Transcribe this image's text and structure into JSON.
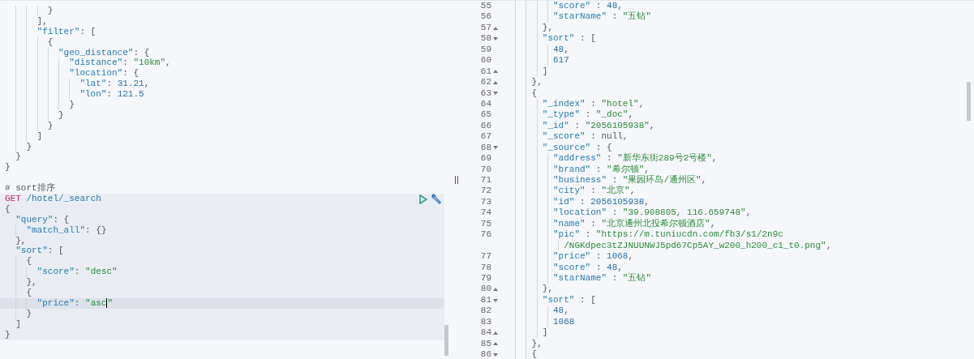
{
  "console": {
    "lines": [
      {
        "segments": [
          {
            "kind": "punct",
            "text": "        }"
          }
        ]
      },
      {
        "segments": [
          {
            "kind": "punct",
            "text": "      ],"
          }
        ]
      },
      {
        "segments": [
          {
            "kind": "key",
            "text": "      \"filter\""
          },
          {
            "kind": "punct",
            "text": ": ["
          }
        ]
      },
      {
        "segments": [
          {
            "kind": "punct",
            "text": "        {"
          }
        ]
      },
      {
        "segments": [
          {
            "kind": "key",
            "text": "          \"geo_distance\""
          },
          {
            "kind": "punct",
            "text": ": {"
          }
        ]
      },
      {
        "segments": [
          {
            "kind": "key",
            "text": "            \"distance\""
          },
          {
            "kind": "punct",
            "text": ": "
          },
          {
            "kind": "string",
            "text": "\"10km\""
          },
          {
            "kind": "punct",
            "text": ","
          }
        ]
      },
      {
        "segments": [
          {
            "kind": "key",
            "text": "            \"location\""
          },
          {
            "kind": "punct",
            "text": ": {"
          }
        ]
      },
      {
        "segments": [
          {
            "kind": "key",
            "text": "              \"lat\""
          },
          {
            "kind": "punct",
            "text": ": "
          },
          {
            "kind": "number",
            "text": "31.21"
          },
          {
            "kind": "punct",
            "text": ","
          }
        ]
      },
      {
        "segments": [
          {
            "kind": "key",
            "text": "              \"lon\""
          },
          {
            "kind": "punct",
            "text": ": "
          },
          {
            "kind": "number",
            "text": "121.5"
          }
        ]
      },
      {
        "segments": [
          {
            "kind": "punct",
            "text": "            }"
          }
        ]
      },
      {
        "segments": [
          {
            "kind": "punct",
            "text": "          }"
          }
        ]
      },
      {
        "segments": [
          {
            "kind": "punct",
            "text": "        }"
          }
        ]
      },
      {
        "segments": [
          {
            "kind": "punct",
            "text": "      ]"
          }
        ]
      },
      {
        "segments": [
          {
            "kind": "punct",
            "text": "    }"
          }
        ]
      },
      {
        "segments": [
          {
            "kind": "punct",
            "text": "  }"
          }
        ]
      },
      {
        "segments": [
          {
            "kind": "punct",
            "text": "}"
          }
        ]
      },
      {
        "segments": [
          {
            "kind": "comment",
            "text": "# sort排序"
          }
        ]
      }
    ],
    "request": {
      "lines": [
        {
          "active": false,
          "segments": [
            {
              "kind": "method",
              "text": "GET"
            },
            {
              "kind": "url",
              "text": " /hotel/_search"
            }
          ]
        },
        {
          "active": false,
          "segments": [
            {
              "kind": "punct",
              "text": "{"
            }
          ]
        },
        {
          "active": false,
          "segments": [
            {
              "kind": "key",
              "text": "  \"query\""
            },
            {
              "kind": "punct",
              "text": ": {"
            }
          ]
        },
        {
          "active": false,
          "segments": [
            {
              "kind": "key",
              "text": "    \"match_all\""
            },
            {
              "kind": "punct",
              "text": ": {}"
            }
          ]
        },
        {
          "active": false,
          "segments": [
            {
              "kind": "punct",
              "text": "  },"
            }
          ]
        },
        {
          "active": false,
          "segments": [
            {
              "kind": "key",
              "text": "  \"sort\""
            },
            {
              "kind": "punct",
              "text": ": ["
            }
          ]
        },
        {
          "active": false,
          "segments": [
            {
              "kind": "punct",
              "text": "    {"
            }
          ]
        },
        {
          "active": false,
          "segments": [
            {
              "kind": "key",
              "text": "      \"score\""
            },
            {
              "kind": "punct",
              "text": ": "
            },
            {
              "kind": "string",
              "text": "\"desc\""
            }
          ]
        },
        {
          "active": false,
          "segments": [
            {
              "kind": "punct",
              "text": "    },"
            }
          ]
        },
        {
          "active": false,
          "segments": [
            {
              "kind": "punct",
              "text": "    {"
            }
          ]
        },
        {
          "active": true,
          "segments": [
            {
              "kind": "key",
              "text": "      \"price\""
            },
            {
              "kind": "punct",
              "text": ": "
            },
            {
              "kind": "string",
              "text": "\"asc"
            },
            {
              "kind": "cursor"
            },
            {
              "kind": "string",
              "text": "\""
            }
          ]
        },
        {
          "active": false,
          "segments": [
            {
              "kind": "punct",
              "text": "    }"
            }
          ]
        },
        {
          "active": false,
          "segments": [
            {
              "kind": "punct",
              "text": "  ]"
            }
          ]
        },
        {
          "active": false,
          "segments": [
            {
              "kind": "punct",
              "text": "}"
            }
          ]
        }
      ]
    }
  },
  "response": {
    "lines": [
      {
        "number": "55",
        "segments": [
          {
            "kind": "key",
            "text": "          \"score\""
          },
          {
            "kind": "punct",
            "text": " : "
          },
          {
            "kind": "number",
            "text": "48"
          },
          {
            "kind": "punct",
            "text": ","
          }
        ]
      },
      {
        "number": "56",
        "segments": [
          {
            "kind": "key",
            "text": "          \"starName\""
          },
          {
            "kind": "punct",
            "text": " : "
          },
          {
            "kind": "string",
            "text": "\"五钻\""
          }
        ]
      },
      {
        "number": "57",
        "block_end": true,
        "segments": [
          {
            "kind": "punct",
            "text": "        },"
          }
        ]
      },
      {
        "number": "58",
        "collapsible": true,
        "segments": [
          {
            "kind": "key",
            "text": "        \"sort\""
          },
          {
            "kind": "punct",
            "text": " : ["
          }
        ]
      },
      {
        "number": "59",
        "segments": [
          {
            "kind": "number",
            "text": "          48"
          },
          {
            "kind": "punct",
            "text": ","
          }
        ]
      },
      {
        "number": "60",
        "segments": [
          {
            "kind": "number",
            "text": "          617"
          }
        ]
      },
      {
        "number": "61",
        "block_end": true,
        "segments": [
          {
            "kind": "punct",
            "text": "        ]"
          }
        ]
      },
      {
        "number": "62",
        "block_end": true,
        "segments": [
          {
            "kind": "punct",
            "text": "      },"
          }
        ]
      },
      {
        "number": "63",
        "collapsible": true,
        "segments": [
          {
            "kind": "punct",
            "text": "      {"
          }
        ]
      },
      {
        "number": "64",
        "segments": [
          {
            "kind": "key",
            "text": "        \"_index\""
          },
          {
            "kind": "punct",
            "text": " : "
          },
          {
            "kind": "string",
            "text": "\"hotel\""
          },
          {
            "kind": "punct",
            "text": ","
          }
        ]
      },
      {
        "number": "65",
        "segments": [
          {
            "kind": "key",
            "text": "        \"_type\""
          },
          {
            "kind": "punct",
            "text": " : "
          },
          {
            "kind": "string",
            "text": "\"_doc\""
          },
          {
            "kind": "punct",
            "text": ","
          }
        ]
      },
      {
        "number": "66",
        "segments": [
          {
            "kind": "key",
            "text": "        \"_id\""
          },
          {
            "kind": "punct",
            "text": " : "
          },
          {
            "kind": "string",
            "text": "\"2056105938\""
          },
          {
            "kind": "punct",
            "text": ","
          }
        ]
      },
      {
        "number": "67",
        "segments": [
          {
            "kind": "key",
            "text": "        \"_score\""
          },
          {
            "kind": "punct",
            "text": " : null,"
          }
        ]
      },
      {
        "number": "68",
        "collapsible": true,
        "segments": [
          {
            "kind": "key",
            "text": "        \"_source\""
          },
          {
            "kind": "punct",
            "text": " : {"
          }
        ]
      },
      {
        "number": "69",
        "segments": [
          {
            "kind": "key",
            "text": "          \"address\""
          },
          {
            "kind": "punct",
            "text": " : "
          },
          {
            "kind": "string",
            "text": "\"新华东街289号2号楼\""
          },
          {
            "kind": "punct",
            "text": ","
          }
        ]
      },
      {
        "number": "70",
        "segments": [
          {
            "kind": "key",
            "text": "          \"brand\""
          },
          {
            "kind": "punct",
            "text": " : "
          },
          {
            "kind": "string",
            "text": "\"希尔顿\""
          },
          {
            "kind": "punct",
            "text": ","
          }
        ]
      },
      {
        "number": "71",
        "segments": [
          {
            "kind": "key",
            "text": "          \"business\""
          },
          {
            "kind": "punct",
            "text": " : "
          },
          {
            "kind": "string",
            "text": "\"果园环岛/通州区\""
          },
          {
            "kind": "punct",
            "text": ","
          }
        ]
      },
      {
        "number": "72",
        "segments": [
          {
            "kind": "key",
            "text": "          \"city\""
          },
          {
            "kind": "punct",
            "text": " : "
          },
          {
            "kind": "string",
            "text": "\"北京\""
          },
          {
            "kind": "punct",
            "text": ","
          }
        ]
      },
      {
        "number": "73",
        "segments": [
          {
            "kind": "key",
            "text": "          \"id\""
          },
          {
            "kind": "punct",
            "text": " : "
          },
          {
            "kind": "number",
            "text": "2056105938"
          },
          {
            "kind": "punct",
            "text": ","
          }
        ]
      },
      {
        "number": "74",
        "segments": [
          {
            "kind": "key",
            "text": "          \"location\""
          },
          {
            "kind": "punct",
            "text": " : "
          },
          {
            "kind": "string",
            "text": "\"39.908805, 116.659748\""
          },
          {
            "kind": "punct",
            "text": ","
          }
        ]
      },
      {
        "number": "75",
        "segments": [
          {
            "kind": "key",
            "text": "          \"name\""
          },
          {
            "kind": "punct",
            "text": " : "
          },
          {
            "kind": "string",
            "text": "\"北京通州北投希尔顿酒店\""
          },
          {
            "kind": "punct",
            "text": ","
          }
        ]
      },
      {
        "number": "76",
        "segments": [
          {
            "kind": "key",
            "text": "          \"pic\""
          },
          {
            "kind": "punct",
            "text": " : "
          },
          {
            "kind": "string",
            "text": "\"https://m.tuniucdn.com/fb3/s1/2n9c"
          }
        ]
      },
      {
        "segments": [
          {
            "kind": "string",
            "text": "            /NGKdpec3tZJNUUNWJ5pd67Cp5AY_w200_h200_c1_t0.png\""
          },
          {
            "kind": "punct",
            "text": ","
          }
        ]
      },
      {
        "number": "77",
        "segments": [
          {
            "kind": "key",
            "text": "          \"price\""
          },
          {
            "kind": "punct",
            "text": " : "
          },
          {
            "kind": "number",
            "text": "1068"
          },
          {
            "kind": "punct",
            "text": ","
          }
        ]
      },
      {
        "number": "78",
        "segments": [
          {
            "kind": "key",
            "text": "          \"score\""
          },
          {
            "kind": "punct",
            "text": " : "
          },
          {
            "kind": "number",
            "text": "48"
          },
          {
            "kind": "punct",
            "text": ","
          }
        ]
      },
      {
        "number": "79",
        "segments": [
          {
            "kind": "key",
            "text": "          \"starName\""
          },
          {
            "kind": "punct",
            "text": " : "
          },
          {
            "kind": "string",
            "text": "\"五钻\""
          }
        ]
      },
      {
        "number": "80",
        "block_end": true,
        "segments": [
          {
            "kind": "punct",
            "text": "        },"
          }
        ]
      },
      {
        "number": "81",
        "collapsible": true,
        "segments": [
          {
            "kind": "key",
            "text": "        \"sort\""
          },
          {
            "kind": "punct",
            "text": " : ["
          }
        ]
      },
      {
        "number": "82",
        "segments": [
          {
            "kind": "number",
            "text": "          48"
          },
          {
            "kind": "punct",
            "text": ","
          }
        ]
      },
      {
        "number": "83",
        "segments": [
          {
            "kind": "number",
            "text": "          1068"
          }
        ]
      },
      {
        "number": "84",
        "block_end": true,
        "segments": [
          {
            "kind": "punct",
            "text": "        ]"
          }
        ]
      },
      {
        "number": "85",
        "block_end": true,
        "segments": [
          {
            "kind": "punct",
            "text": "      },"
          }
        ]
      },
      {
        "number": "86",
        "collapsible": true,
        "segments": [
          {
            "kind": "punct",
            "text": "      {"
          }
        ]
      }
    ]
  }
}
